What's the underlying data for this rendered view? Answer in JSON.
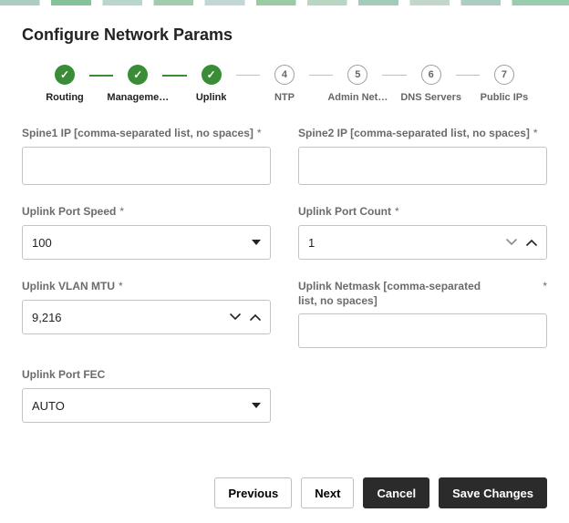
{
  "title": "Configure Network Params",
  "steps": [
    {
      "label": "Routing",
      "state": "done"
    },
    {
      "label": "Manageme…",
      "state": "done"
    },
    {
      "label": "Uplink",
      "state": "done"
    },
    {
      "num": "4",
      "label": "NTP",
      "state": "pending"
    },
    {
      "num": "5",
      "label": "Admin Net…",
      "state": "pending"
    },
    {
      "num": "6",
      "label": "DNS Servers",
      "state": "pending"
    },
    {
      "num": "7",
      "label": "Public IPs",
      "state": "pending"
    }
  ],
  "fields": {
    "spine1": {
      "label": "Spine1 IP [comma-separated list, no spaces]",
      "value": "",
      "required": true
    },
    "spine2": {
      "label": "Spine2 IP [comma-separated list, no spaces]",
      "value": "",
      "required": true
    },
    "speed": {
      "label": "Uplink Port Speed",
      "value": "100",
      "required": true
    },
    "count": {
      "label": "Uplink Port Count",
      "value": "1",
      "required": true
    },
    "mtu": {
      "label": "Uplink VLAN MTU",
      "value": "9,216",
      "required": true
    },
    "netmask": {
      "label": "Uplink Netmask [comma-separated list, no spaces]",
      "value": "",
      "required": true
    },
    "fec": {
      "label": "Uplink Port FEC",
      "value": "AUTO",
      "required": false
    }
  },
  "buttons": {
    "previous": "Previous",
    "next": "Next",
    "cancel": "Cancel",
    "save": "Save Changes"
  },
  "colors": {
    "stepDone": "#3a8d36",
    "btnDark": "#2b2b2b",
    "border": "#c4c4c4",
    "labelGrey": "#6b6b6b"
  }
}
